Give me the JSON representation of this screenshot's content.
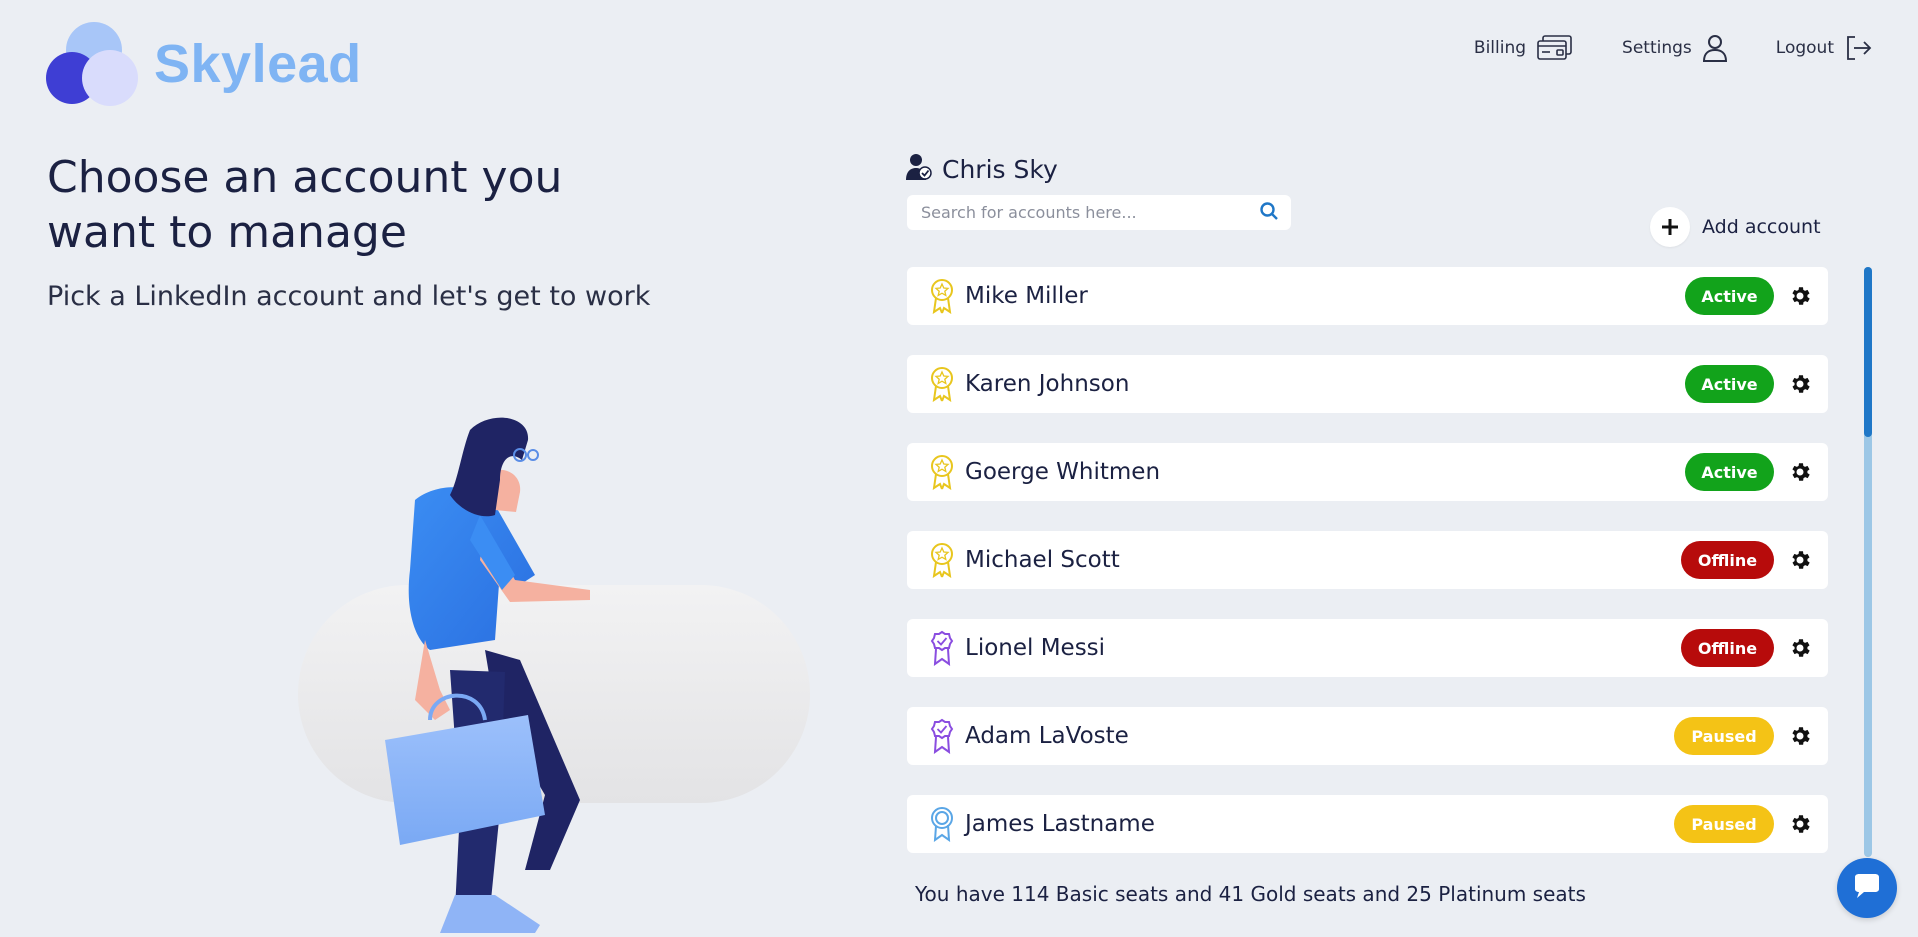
{
  "brand": {
    "name": "Skylead"
  },
  "nav": {
    "billing": "Billing",
    "settings": "Settings",
    "logout": "Logout"
  },
  "hero": {
    "title": "Choose an account you want to manage",
    "subtitle": "Pick a LinkedIn account and let's get to work"
  },
  "user": {
    "name": "Chris Sky"
  },
  "search": {
    "placeholder": "Search for accounts here..."
  },
  "add_account": {
    "label": "Add account"
  },
  "accounts": [
    {
      "name": "Mike Miller",
      "status": "Active",
      "tier": "gold"
    },
    {
      "name": "Karen Johnson",
      "status": "Active",
      "tier": "gold"
    },
    {
      "name": "Goerge Whitmen",
      "status": "Active",
      "tier": "gold"
    },
    {
      "name": "Michael Scott",
      "status": "Offline",
      "tier": "gold"
    },
    {
      "name": "Lionel Messi",
      "status": "Offline",
      "tier": "platinum"
    },
    {
      "name": "Adam LaVoste",
      "status": "Paused",
      "tier": "platinum"
    },
    {
      "name": "James Lastname",
      "status": "Paused",
      "tier": "basic"
    }
  ],
  "seats_summary": "You have 114 Basic seats and 41 Gold seats and 25 Platinum seats",
  "colors": {
    "active": "#12a31b",
    "offline": "#b70b0b",
    "paused": "#f4c316",
    "gold_icon": "#e8c61e",
    "platinum_icon": "#8a4de0",
    "basic_icon": "#5aa6e6",
    "brand_text": "#7fb4f3",
    "scroll_thumb": "#1f77c7"
  },
  "icons": {
    "billing": "credit-card-icon",
    "settings": "user-icon",
    "logout": "logout-icon",
    "search": "search-icon",
    "add": "plus-icon",
    "row_action": "gear-icon",
    "chat": "chat-icon",
    "user": "user-verified-icon"
  }
}
